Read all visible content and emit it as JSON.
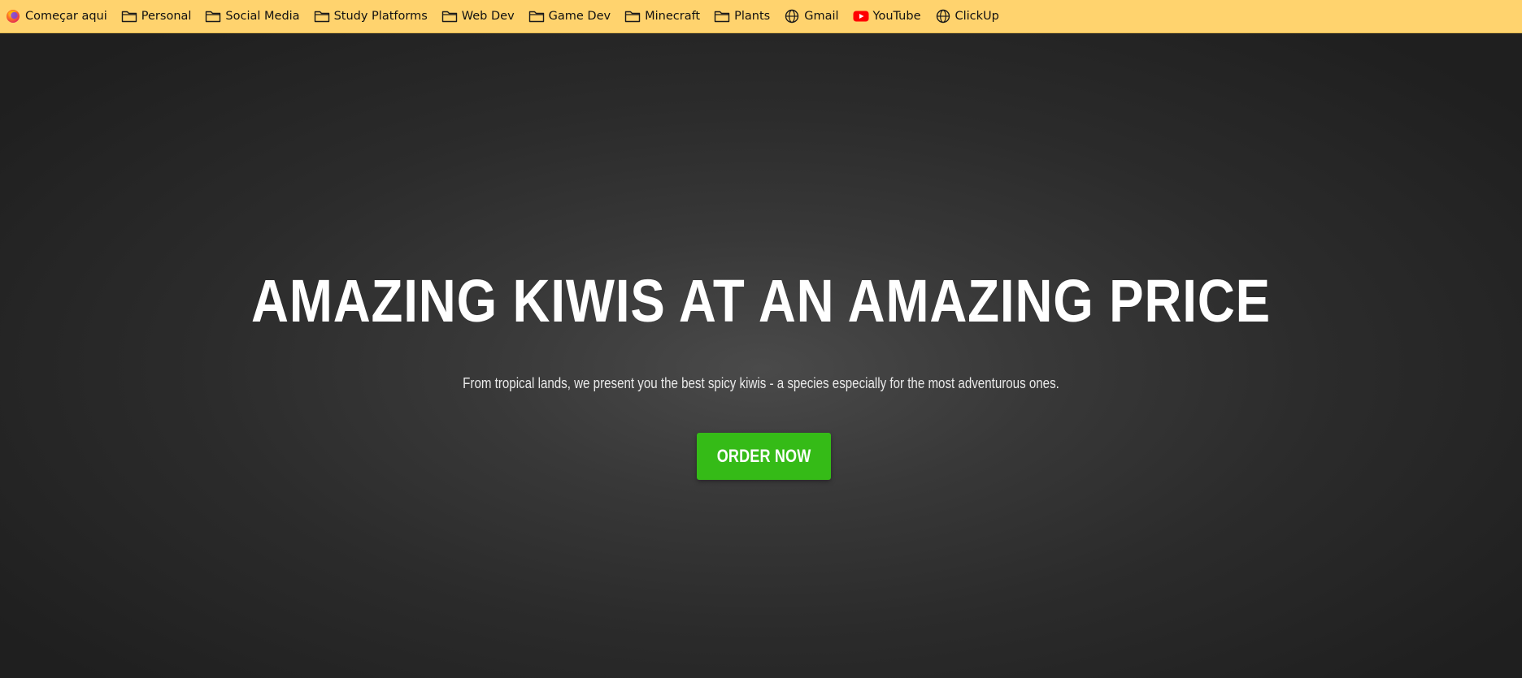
{
  "bookmarks": [
    {
      "label": "Começar aqui",
      "icon": "firefox-icon"
    },
    {
      "label": "Personal",
      "icon": "folder-icon"
    },
    {
      "label": "Social Media",
      "icon": "folder-icon"
    },
    {
      "label": "Study Platforms",
      "icon": "folder-icon"
    },
    {
      "label": "Web Dev",
      "icon": "folder-icon"
    },
    {
      "label": "Game Dev",
      "icon": "folder-icon"
    },
    {
      "label": "Minecraft",
      "icon": "folder-icon"
    },
    {
      "label": "Plants",
      "icon": "folder-icon"
    },
    {
      "label": "Gmail",
      "icon": "globe-icon"
    },
    {
      "label": "YouTube",
      "icon": "youtube-icon"
    },
    {
      "label": "ClickUp",
      "icon": "globe-icon"
    }
  ],
  "hero": {
    "title": "AMAZING KIWIS AT AN AMAZING PRICE",
    "subtitle": "From tropical lands, we present you the best spicy kiwis - a species especially for the most adventurous ones.",
    "cta_label": "ORDER NOW"
  },
  "colors": {
    "bookmarks_bar": "#ffd36e",
    "cta": "#35bb17",
    "hero_background": "#2b2b2b"
  }
}
